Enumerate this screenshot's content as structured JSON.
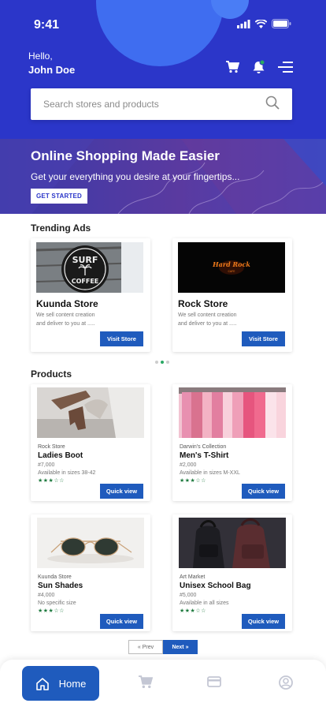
{
  "status": {
    "time": "9:41"
  },
  "greeting": {
    "hello": "Hello,",
    "name": "John Doe"
  },
  "search": {
    "placeholder": "Search stores and products"
  },
  "banner": {
    "title": "Online Shopping Made Easier",
    "subtitle": "Get your everything you desire at your fingertips...",
    "cta": "GET STARTED"
  },
  "trending": {
    "title": "Trending Ads",
    "items": [
      {
        "name": "Kuunda Store",
        "desc_line1": "We sell content creation",
        "desc_line2": "and deliver to you at .....",
        "button": "Visit Store",
        "image": "surf-coffee-sign"
      },
      {
        "name": "Rock Store",
        "desc_line1": "We sell content creation",
        "desc_line2": "and deliver to you at .....",
        "button": "Visit Store",
        "image": "hard-rock-cafe-sign"
      }
    ],
    "page_count": 3,
    "active_page": 2
  },
  "products": {
    "title": "Products",
    "items": [
      {
        "store": "Rock Store",
        "name": "Ladies Boot",
        "price": "#7,000",
        "availability": "Available in sizes 38-42",
        "stars": "★★★☆☆",
        "button": "Quick view"
      },
      {
        "store": "Darwin's Collection",
        "name": "Men's T-Shirt",
        "price": "#2,000",
        "availability": "Available in sizes M-XXL",
        "stars": "★★★☆☆",
        "button": "Quick view"
      },
      {
        "store": "Kuunda Store",
        "name": "Sun Shades",
        "price": "#4,000",
        "availability": "No specific size",
        "stars": "★★★☆☆",
        "button": "Quick view"
      },
      {
        "store": "Art Market",
        "name": "Unisex School Bag",
        "price": "#5,000",
        "availability": "Available in all sizes",
        "stars": "★★★☆☆",
        "button": "Quick view"
      }
    ]
  },
  "pagination": {
    "prev": "Prev",
    "next": "Next"
  },
  "nav": {
    "home": "Home",
    "items": [
      "home-icon",
      "cart-icon",
      "card-icon",
      "profile-icon"
    ]
  },
  "colors": {
    "primary": "#2b36c9",
    "button": "#1f5bbd",
    "star": "#1e7a3e",
    "accent_dot": "#2aa864"
  }
}
